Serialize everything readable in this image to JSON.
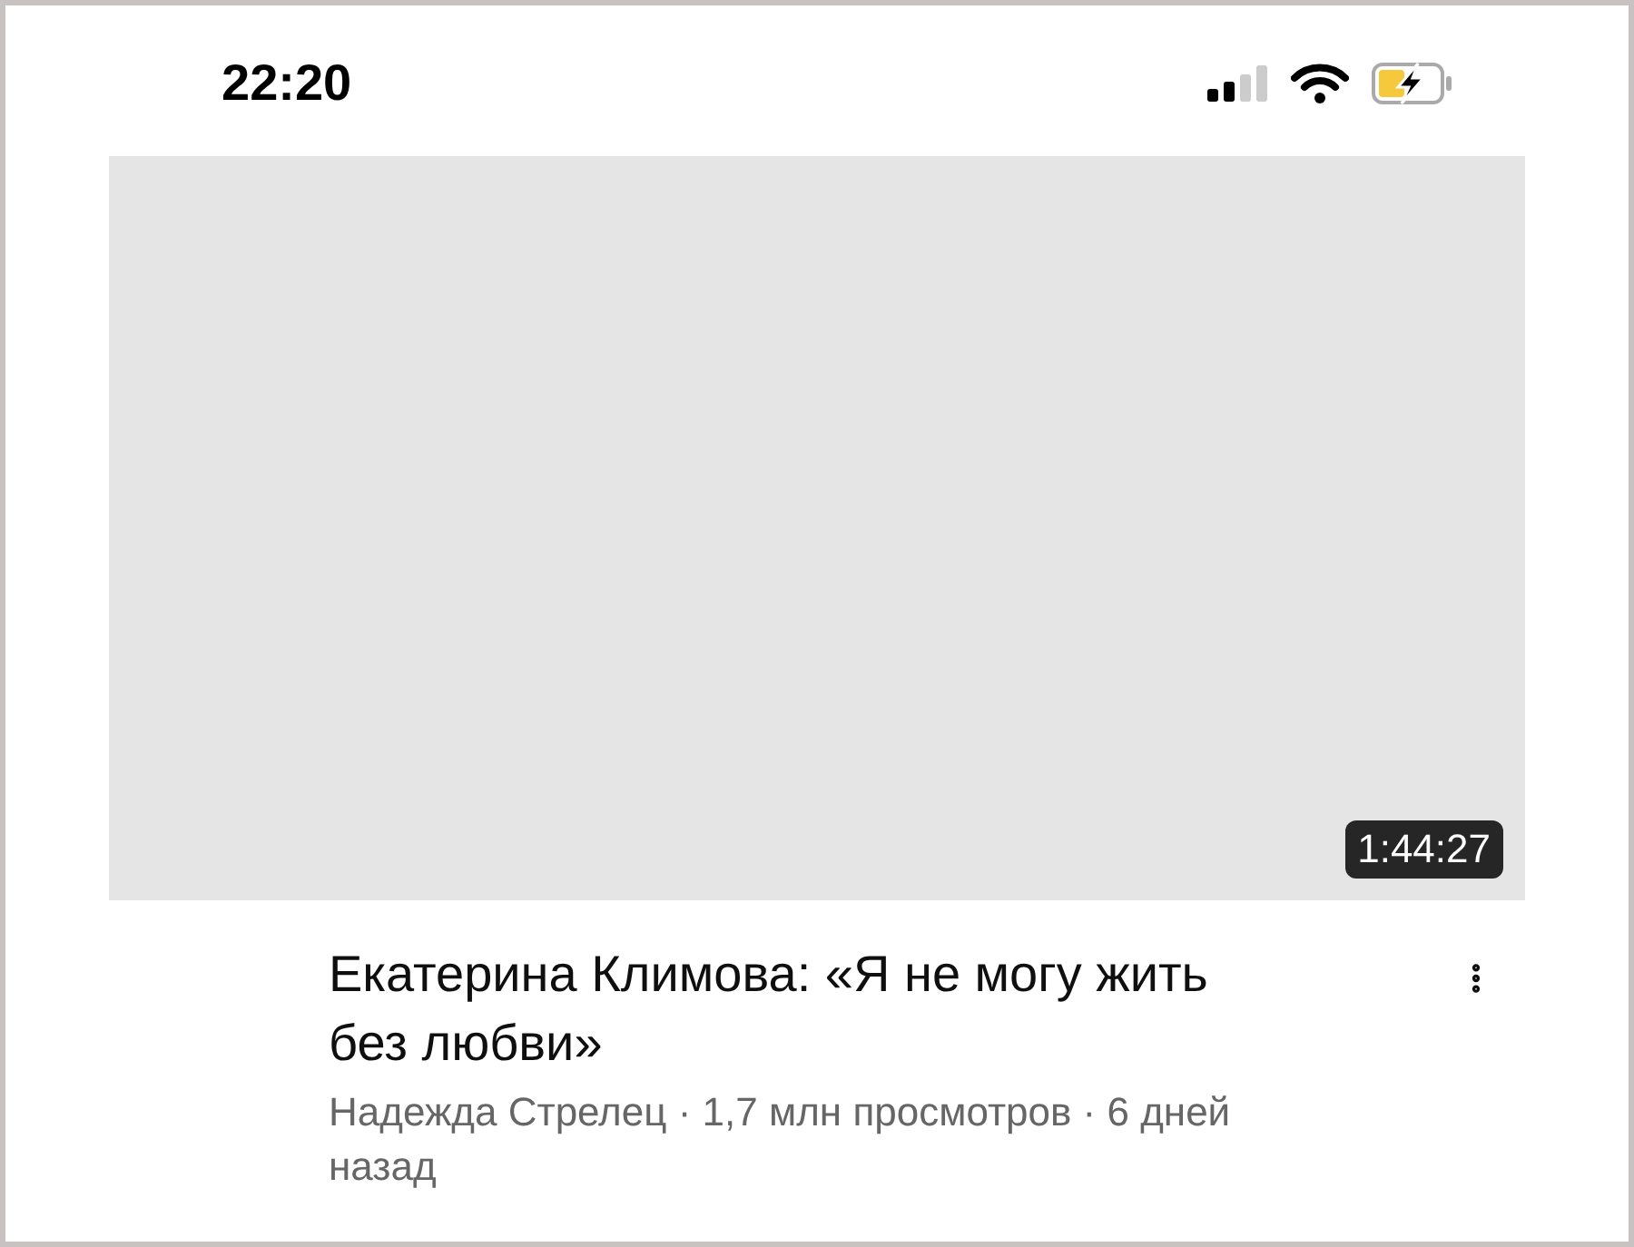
{
  "status_bar": {
    "time": "22:20",
    "battery": {
      "charging": true
    }
  },
  "video": {
    "duration": "1:44:27",
    "title": "Екатерина Климова: «Я не могу жить без любви»",
    "meta": "Надежда Стрелец · 1,7 млн просмотров · 6 дней назад"
  }
}
